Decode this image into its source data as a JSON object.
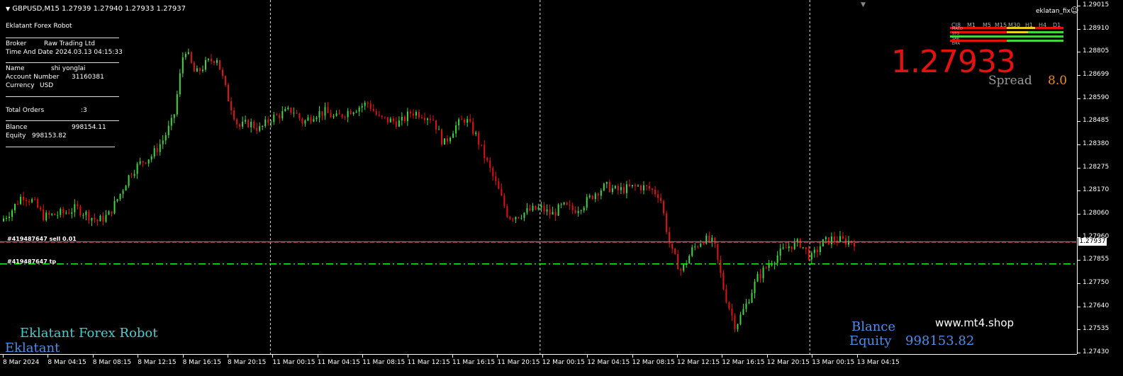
{
  "header": {
    "symbol_line": "GBPUSD,M15  1.27939 1.27940 1.27933 1.27937",
    "ea_name": "eklatan_fix",
    "ea_icon": "smiley-icon"
  },
  "info_panel": {
    "title": "Eklatant Forex Robot",
    "broker_label": "Broker",
    "broker_value": "Raw Trading Ltd",
    "time_label": "Time And Date",
    "time_value": "2024.03.13 04:15:33",
    "name_label": "Name",
    "name_value": "shi yonglai",
    "account_label": "Account Number",
    "account_value": "31160381",
    "currency_label": "Currency",
    "currency_value": "USD",
    "orders_label": "Total Orders",
    "orders_value": ":3",
    "balance_label": "Blance",
    "balance_value": "998154.11",
    "equity_label": "Equity",
    "equity_value": "998153.82"
  },
  "order_lines": {
    "sell_label": "#419487647 sell 0.01",
    "tp_label": "#419487647 tp"
  },
  "price_panel": {
    "big_price": "1.27933",
    "spread_label": "Spread",
    "spread_value": "8.0",
    "timeframes": [
      "CJ8",
      "M1",
      "M5",
      "M15",
      "M30",
      "H1",
      "H4",
      "D1"
    ],
    "indicators": [
      "MACD",
      "STO",
      "SAR",
      "EMA"
    ]
  },
  "branding": {
    "robot_name": "Eklatant Forex Robot",
    "short_name": "Eklatant",
    "website": "www.mt4.shop",
    "balance_label": "Blance",
    "equity_label": "Equity",
    "equity_value": "998153.82"
  },
  "colors": {
    "background": "#000000",
    "bull": "#3fd63f",
    "bear": "#e4110f",
    "tp_line": "#22ee22",
    "big_price": "#e4110f",
    "branding_cyan": "#40d0d0",
    "branding_blue": "#4f8ee8"
  },
  "chart_data": {
    "type": "candlestick",
    "symbol": "GBPUSD",
    "timeframe": "M15",
    "ylim": [
      1.2743,
      1.29015
    ],
    "y_ticks": [
      "1.29015",
      "1.28910",
      "1.28805",
      "1.28699",
      "1.28590",
      "1.28485",
      "1.28380",
      "1.28275",
      "1.28170",
      "1.28060",
      "1.27960",
      "1.27855",
      "1.27750",
      "1.27640",
      "1.27535",
      "1.27430"
    ],
    "current_price": "1.27937",
    "current_price_value": 1.27937,
    "tp_price_value": 1.27835,
    "x_ticks": [
      "8 Mar 2024",
      "8 Mar 04:15",
      "8 Mar 08:15",
      "8 Mar 12:15",
      "8 Mar 16:15",
      "8 Mar 20:15",
      "11 Mar 00:15",
      "11 Mar 04:15",
      "11 Mar 08:15",
      "11 Mar 12:15",
      "11 Mar 16:15",
      "11 Mar 20:15",
      "12 Mar 00:15",
      "12 Mar 04:15",
      "12 Mar 08:15",
      "12 Mar 12:15",
      "12 Mar 16:15",
      "12 Mar 20:15",
      "13 Mar 00:15",
      "13 Mar 04:15"
    ],
    "session_separators": [
      "11 Mar 00:15",
      "12 Mar 00:15",
      "13 Mar 00:15"
    ],
    "close_path": [
      1.2803,
      1.2808,
      1.2815,
      1.2812,
      1.2805,
      1.2806,
      1.2807,
      1.2809,
      1.2806,
      1.2803,
      1.2806,
      1.2815,
      1.2825,
      1.283,
      1.2833,
      1.284,
      1.285,
      1.2883,
      1.287,
      1.2875,
      1.2878,
      1.286,
      1.2846,
      1.2848,
      1.2845,
      1.285,
      1.2852,
      1.2854,
      1.2848,
      1.2852,
      1.2853,
      1.285,
      1.2853,
      1.2855,
      1.2857,
      1.285,
      1.2849,
      1.2848,
      1.2853,
      1.2852,
      1.285,
      1.2838,
      1.2846,
      1.285,
      1.2842,
      1.283,
      1.2818,
      1.2805,
      1.2806,
      1.2808,
      1.2809,
      1.2806,
      1.281,
      1.2808,
      1.2811,
      1.2816,
      1.2819,
      1.2817,
      1.2818,
      1.2819,
      1.2818,
      1.2815,
      1.279,
      1.278,
      1.279,
      1.2795,
      1.2793,
      1.277,
      1.2755,
      1.2765,
      1.2777,
      1.2783,
      1.2788,
      1.2792,
      1.2793,
      1.2786,
      1.2793,
      1.2795,
      1.2794,
      1.27937
    ]
  }
}
